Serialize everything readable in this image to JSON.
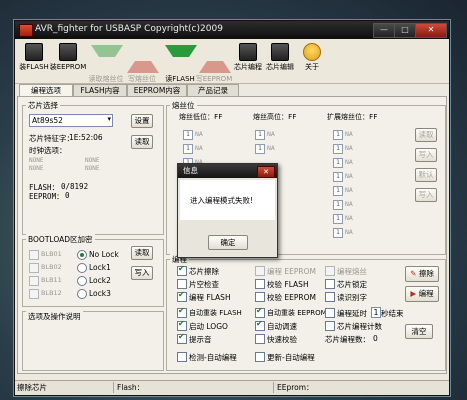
{
  "window": {
    "title": "AVR_fighter for USBASP Copyright(c)2009"
  },
  "titlebar": {
    "min_label": "—",
    "max_label": "□",
    "close_label": "✕"
  },
  "toolbar": [
    {
      "label": "装FLASH",
      "icon": "chip-flash-icon",
      "enabled": true
    },
    {
      "label": "装EEPROM",
      "icon": "chip-eeprom-icon",
      "enabled": true
    },
    {
      "label": "读取熔丝位",
      "icon": "read-fuse-icon",
      "enabled": false
    },
    {
      "label": "写熔丝位",
      "icon": "write-fuse-icon",
      "enabled": false
    },
    {
      "label": "读FLASH",
      "icon": "read-flash-icon",
      "enabled": true
    },
    {
      "label": "写EEPROM",
      "icon": "write-eeprom-icon",
      "enabled": false
    },
    {
      "label": "芯片编程",
      "icon": "program-chip-icon",
      "enabled": true
    },
    {
      "label": "芯片编辑",
      "icon": "edit-chip-icon",
      "enabled": true
    },
    {
      "label": "关于",
      "icon": "about-icon",
      "enabled": true
    }
  ],
  "tabs": [
    "编程选项",
    "FLASH内容",
    "EEPROM内容",
    "产品记录"
  ],
  "chip_select": {
    "title": "芯片选择",
    "selected": "At89s52",
    "set_label": "设置",
    "signature_label": "芯片特征字：",
    "signature_value": "1E:52:06",
    "read_label": "读取",
    "clock_label": "时钟选项：",
    "clock_values": [
      "NONE",
      "NONE",
      "NONE",
      "NONE"
    ],
    "flash_label": "FLASH：",
    "flash_value": "0/8192",
    "eeprom_label": "EEPROM：",
    "eeprom_value": "0"
  },
  "bootload": {
    "title": "BOOTLOAD区加密",
    "blb": [
      "BLB01",
      "BLB02",
      "BLB11",
      "BLB12"
    ],
    "locks": [
      "No Lock",
      "Lock1",
      "Lock2",
      "Lock3"
    ],
    "read_label": "读取",
    "write_label": "写入"
  },
  "options_desc": {
    "title": "选项及操作说明"
  },
  "fuse": {
    "title": "熔丝位",
    "low": "熔丝低位：FF",
    "high": "熔丝高位：FF",
    "ext": "扩展熔丝位：FF",
    "na": "NA",
    "side_buttons": [
      "读取",
      "写入",
      "默认",
      "写入"
    ]
  },
  "program": {
    "title": "编程",
    "options": [
      {
        "label": "芯片擦除",
        "checked": true,
        "enabled": true
      },
      {
        "label": "编程 EEPROM",
        "checked": false,
        "enabled": false
      },
      {
        "label": "编程熔丝",
        "checked": false,
        "enabled": false
      },
      {
        "label": "片空检查",
        "checked": false,
        "enabled": true
      },
      {
        "label": "校验 FLASH",
        "checked": false,
        "enabled": true
      },
      {
        "label": "芯片锁定",
        "checked": false,
        "enabled": true
      },
      {
        "label": "编程 FLASH",
        "checked": true,
        "enabled": true
      },
      {
        "label": "校验 EEPROM",
        "checked": false,
        "enabled": true
      },
      {
        "label": "读识别字",
        "checked": false,
        "enabled": true
      },
      {
        "label": "自动重装 FLASH",
        "checked": true,
        "enabled": true
      },
      {
        "label": "自动重装 EEPROM",
        "checked": true,
        "enabled": true
      },
      {
        "label": "编程延时",
        "checked": false,
        "enabled": true
      },
      {
        "label": "启动 LOGO",
        "checked": true,
        "enabled": true
      },
      {
        "label": "自动调速",
        "checked": true,
        "enabled": true
      },
      {
        "label": "芯片编程计数",
        "checked": false,
        "enabled": true
      },
      {
        "label": "提示音",
        "checked": true,
        "enabled": true
      },
      {
        "label": "快速校验",
        "checked": false,
        "enabled": true
      },
      {
        "label": "检测-自动编程",
        "checked": false,
        "enabled": true
      },
      {
        "label": "更新-自动编程",
        "checked": false,
        "enabled": true
      }
    ],
    "delay_value": "1",
    "delay_unit": "秒结束",
    "count_label": "芯片编程数：",
    "count_value": "0",
    "erase_btn": "擦除",
    "program_btn": "编程",
    "clear_btn": "清空"
  },
  "status": {
    "left": "擦除芯片",
    "flash": "Flash：",
    "eeprom": "EEprom："
  },
  "dialog": {
    "title": "信息",
    "message": "进入编程模式失败!",
    "ok": "确定",
    "close": "✕"
  }
}
